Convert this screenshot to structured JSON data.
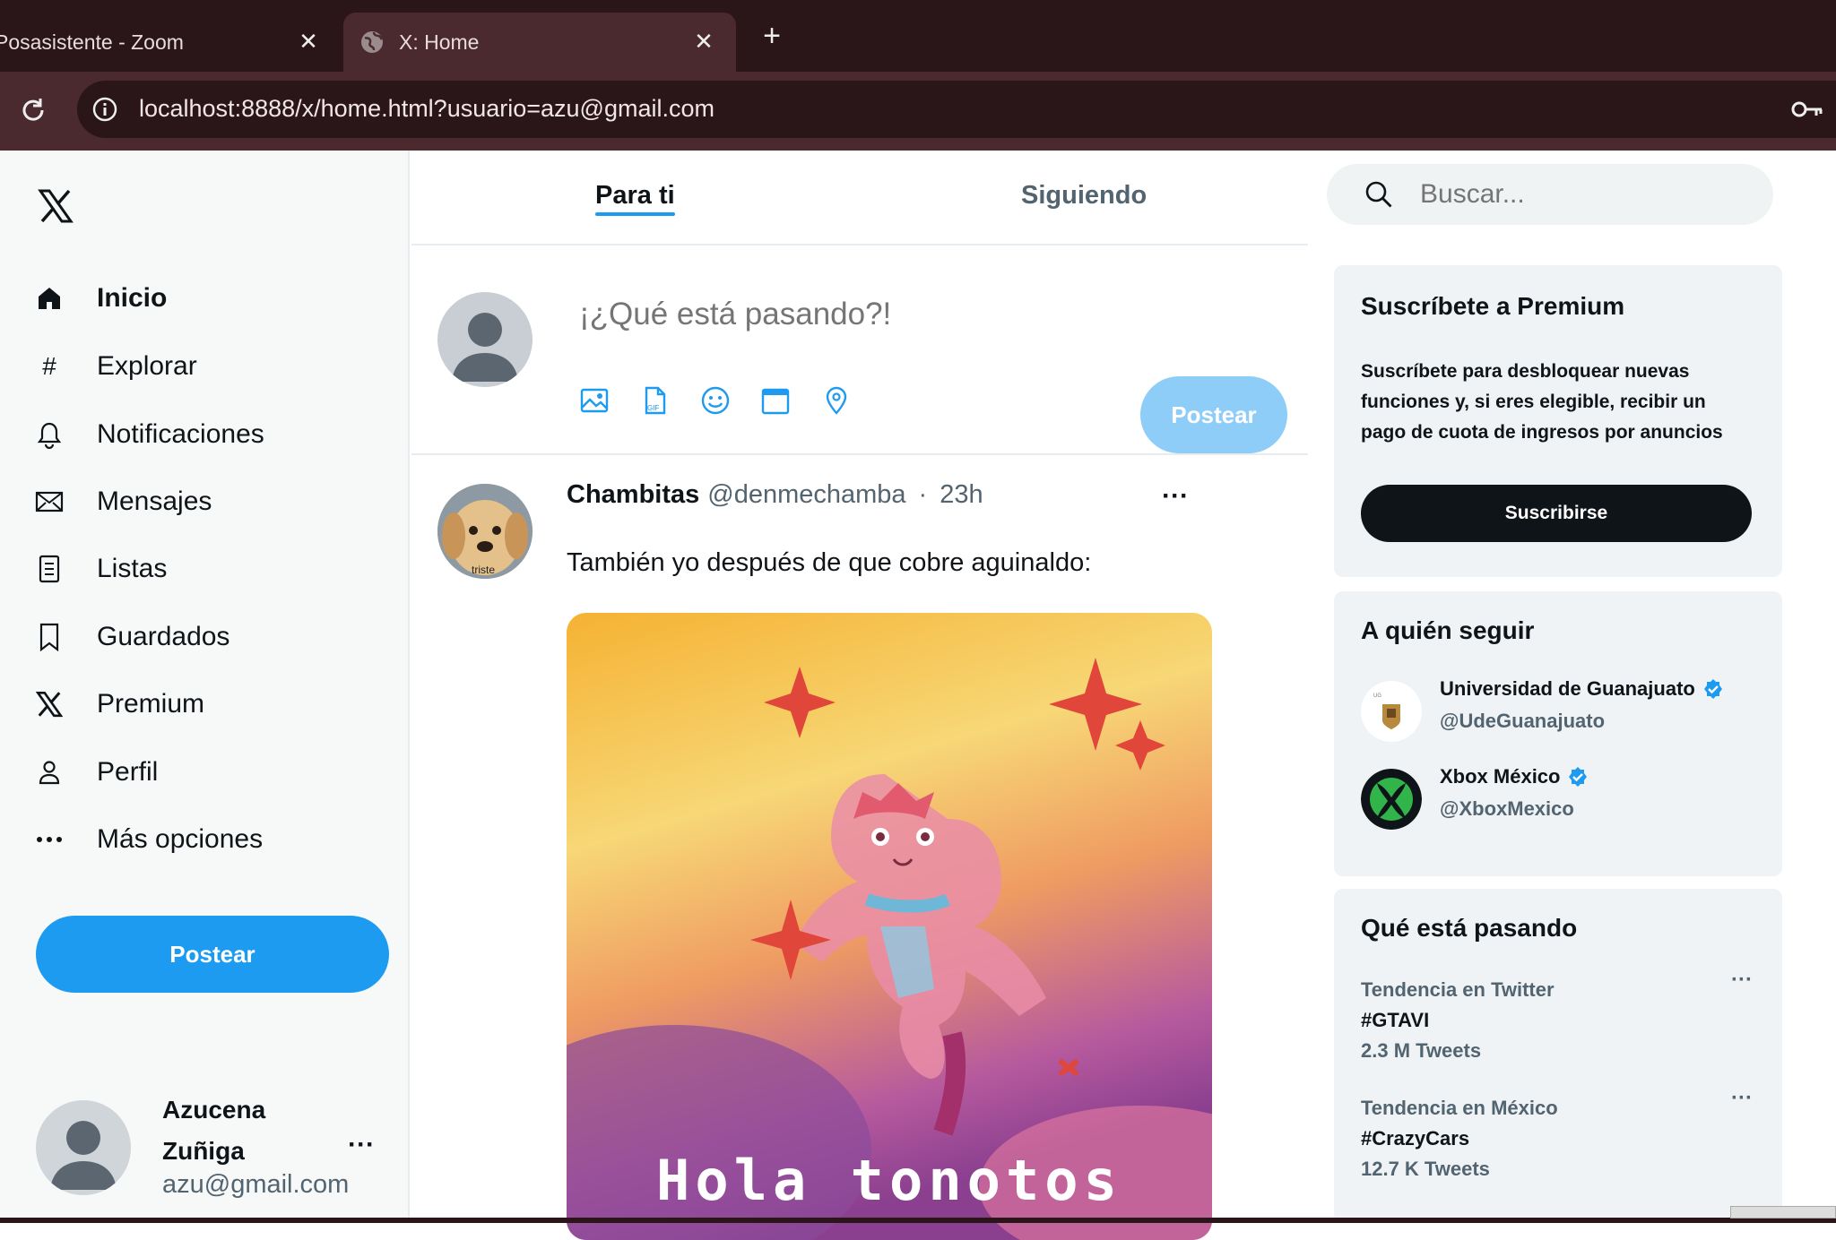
{
  "browser": {
    "tabs": [
      {
        "title": "Posasistente - Zoom",
        "close": "✕"
      },
      {
        "title": "X: Home",
        "close": "✕"
      }
    ],
    "new_tab": "+",
    "url": "localhost:8888/x/home.html?usuario=azu@gmail.com"
  },
  "sidebar": {
    "items": [
      {
        "label": "Inicio",
        "icon": "home-icon"
      },
      {
        "label": "Explorar",
        "icon": "hashtag-icon"
      },
      {
        "label": "Notificaciones",
        "icon": "bell-icon"
      },
      {
        "label": "Mensajes",
        "icon": "envelope-icon"
      },
      {
        "label": "Listas",
        "icon": "list-icon"
      },
      {
        "label": "Guardados",
        "icon": "bookmark-icon"
      },
      {
        "label": "Premium",
        "icon": "x-icon"
      },
      {
        "label": "Perfil",
        "icon": "person-icon"
      },
      {
        "label": "Más opciones",
        "icon": "more-icon"
      }
    ],
    "post_button": "Postear",
    "user": {
      "name": "Azucena Zuñiga",
      "email": "azu@gmail.com",
      "more": "···"
    }
  },
  "feed": {
    "tabs": [
      "Para ti",
      "Siguiendo"
    ],
    "composer": {
      "placeholder": "¡¿Qué está pasando?!",
      "post_button": "Postear"
    },
    "tweet": {
      "name": "Chambitas",
      "handle": "@denmechamba",
      "dot": "·",
      "time": "23h",
      "more": "···",
      "text": "También yo después de que cobre aguinaldo:",
      "avatar_caption": "triste",
      "image_caption": "Hola tonotos"
    }
  },
  "right": {
    "search_placeholder": "Buscar...",
    "premium": {
      "title": "Suscríbete a Premium",
      "text": "Suscríbete para desbloquear nuevas funciones y, si eres elegible, recibir un pago de cuota de ingresos por anuncios",
      "button": "Suscribirse"
    },
    "follow": {
      "title": "A quién seguir",
      "accounts": [
        {
          "name": "Universidad de Guanajuato",
          "handle": "@UdeGuanajuato"
        },
        {
          "name": "Xbox México",
          "handle": "@XboxMexico"
        }
      ]
    },
    "trends": {
      "title": "Qué está pasando",
      "items": [
        {
          "meta": "Tendencia en Twitter",
          "tag": "#GTAVI",
          "count": "2.3 M Tweets",
          "more": "···"
        },
        {
          "meta": "Tendencia en México",
          "tag": "#CrazyCars",
          "count": "12.7 K Tweets",
          "more": "···"
        }
      ]
    }
  },
  "colors": {
    "accent": "#1d9bf0",
    "accent_disabled": "#8ecdf8",
    "chrome_dark": "#2a1518",
    "chrome_tab": "#4a2a2f",
    "verified": "#1d9bf0"
  }
}
